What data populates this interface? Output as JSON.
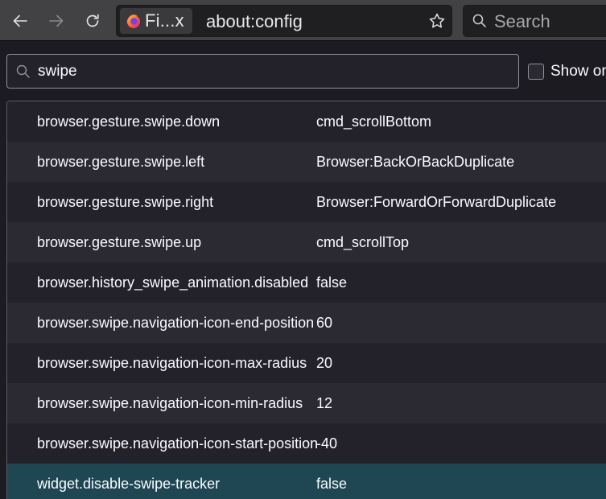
{
  "toolbar": {
    "back_icon": "arrow-left-icon",
    "forward_icon": "arrow-right-icon",
    "reload_icon": "reload-icon",
    "identity_label": "Fi...x",
    "url": "about:config",
    "bookmark_icon": "star-icon",
    "search_placeholder": "Search"
  },
  "filter": {
    "value": "swipe",
    "show_only_modified_label": "Show on"
  },
  "colors": {
    "toolbar_bg": "#424244",
    "page_bg": "#1c1b22",
    "row_bg": "#23222b",
    "row_alt_bg": "#2b2a33",
    "highlight_bg": "#1e4753"
  },
  "prefs": [
    {
      "name": "browser.gesture.swipe.down",
      "value": "cmd_scrollBottom"
    },
    {
      "name": "browser.gesture.swipe.left",
      "value": "Browser:BackOrBackDuplicate"
    },
    {
      "name": "browser.gesture.swipe.right",
      "value": "Browser:ForwardOrForwardDuplicate"
    },
    {
      "name": "browser.gesture.swipe.up",
      "value": "cmd_scrollTop"
    },
    {
      "name": "browser.history_swipe_animation.disabled",
      "value": "false"
    },
    {
      "name": "browser.swipe.navigation-icon-end-position",
      "value": "60"
    },
    {
      "name": "browser.swipe.navigation-icon-max-radius",
      "value": "20"
    },
    {
      "name": "browser.swipe.navigation-icon-min-radius",
      "value": "12"
    },
    {
      "name": "browser.swipe.navigation-icon-start-position",
      "value": "-40"
    },
    {
      "name": "widget.disable-swipe-tracker",
      "value": "false"
    }
  ]
}
